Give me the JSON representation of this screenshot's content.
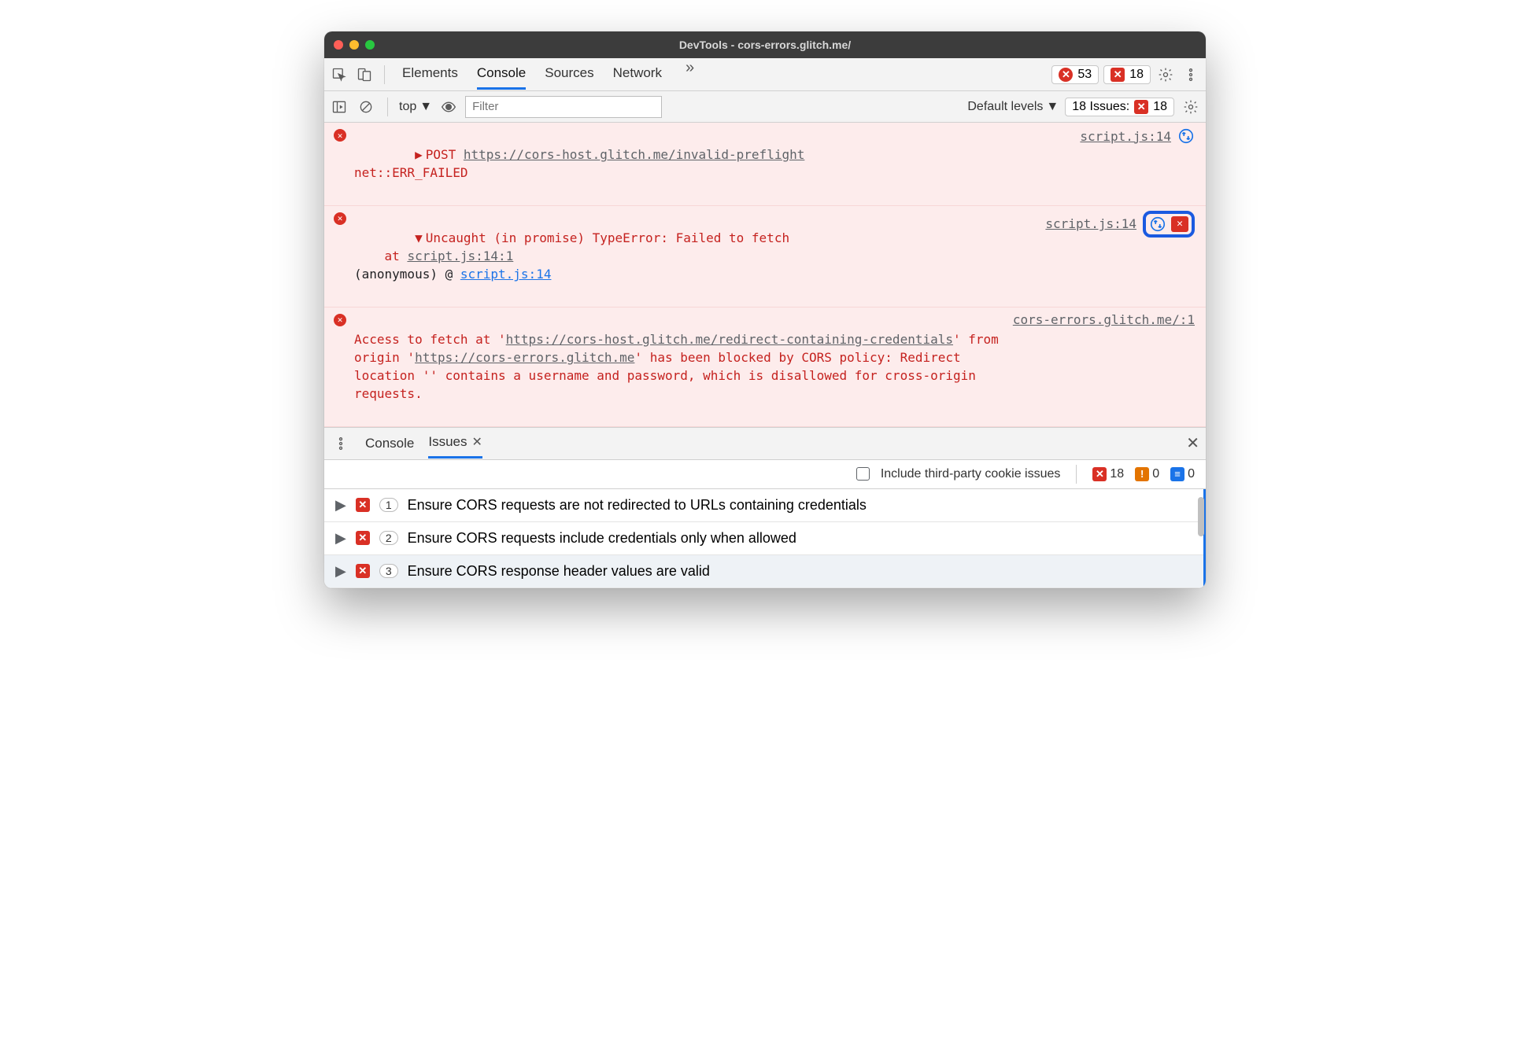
{
  "title": "DevTools - cors-errors.glitch.me/",
  "tabs": {
    "elements": "Elements",
    "console": "Console",
    "sources": "Sources",
    "network": "Network"
  },
  "toolbar1": {
    "error_count": "53",
    "issue_count": "18"
  },
  "toolbar2": {
    "context": "top",
    "filter_placeholder": "Filter",
    "levels": "Default levels",
    "issues_label": "18 Issues:",
    "issues_badge": "18"
  },
  "console_rows": {
    "r1_method": "POST",
    "r1_url": "https://cors-host.glitch.me/invalid-preflight",
    "r1_err": "net::ERR_FAILED",
    "r1_loc": "script.js:14",
    "r2_msg": "Uncaught (in promise) TypeError: Failed to fetch",
    "r2_at": "    at ",
    "r2_at_link": "script.js:14:1",
    "r2_anon": "(anonymous) @ ",
    "r2_anon_link": "script.js:14",
    "r2_loc": "script.js:14",
    "r3_pre": "Access to fetch at '",
    "r3_url1": "https://cors-host.glitch.me/redirect-containing-credentials",
    "r3_mid1": "' from origin '",
    "r3_url2": "https://cors-errors.glitch.me",
    "r3_tail": "' has been blocked by CORS policy: Redirect location '' contains a username and password, which is disallowed for cross-origin requests.",
    "r3_loc": "cors-errors.glitch.me/:1"
  },
  "drawer": {
    "console": "Console",
    "issues": "Issues"
  },
  "issues_bar": {
    "checkbox_label": "Include third-party cookie issues",
    "err": "18",
    "warn": "0",
    "info": "0"
  },
  "issues": [
    {
      "count": "1",
      "text": "Ensure CORS requests are not redirected to URLs containing credentials"
    },
    {
      "count": "2",
      "text": "Ensure CORS requests include credentials only when allowed"
    },
    {
      "count": "3",
      "text": "Ensure CORS response header values are valid"
    }
  ]
}
